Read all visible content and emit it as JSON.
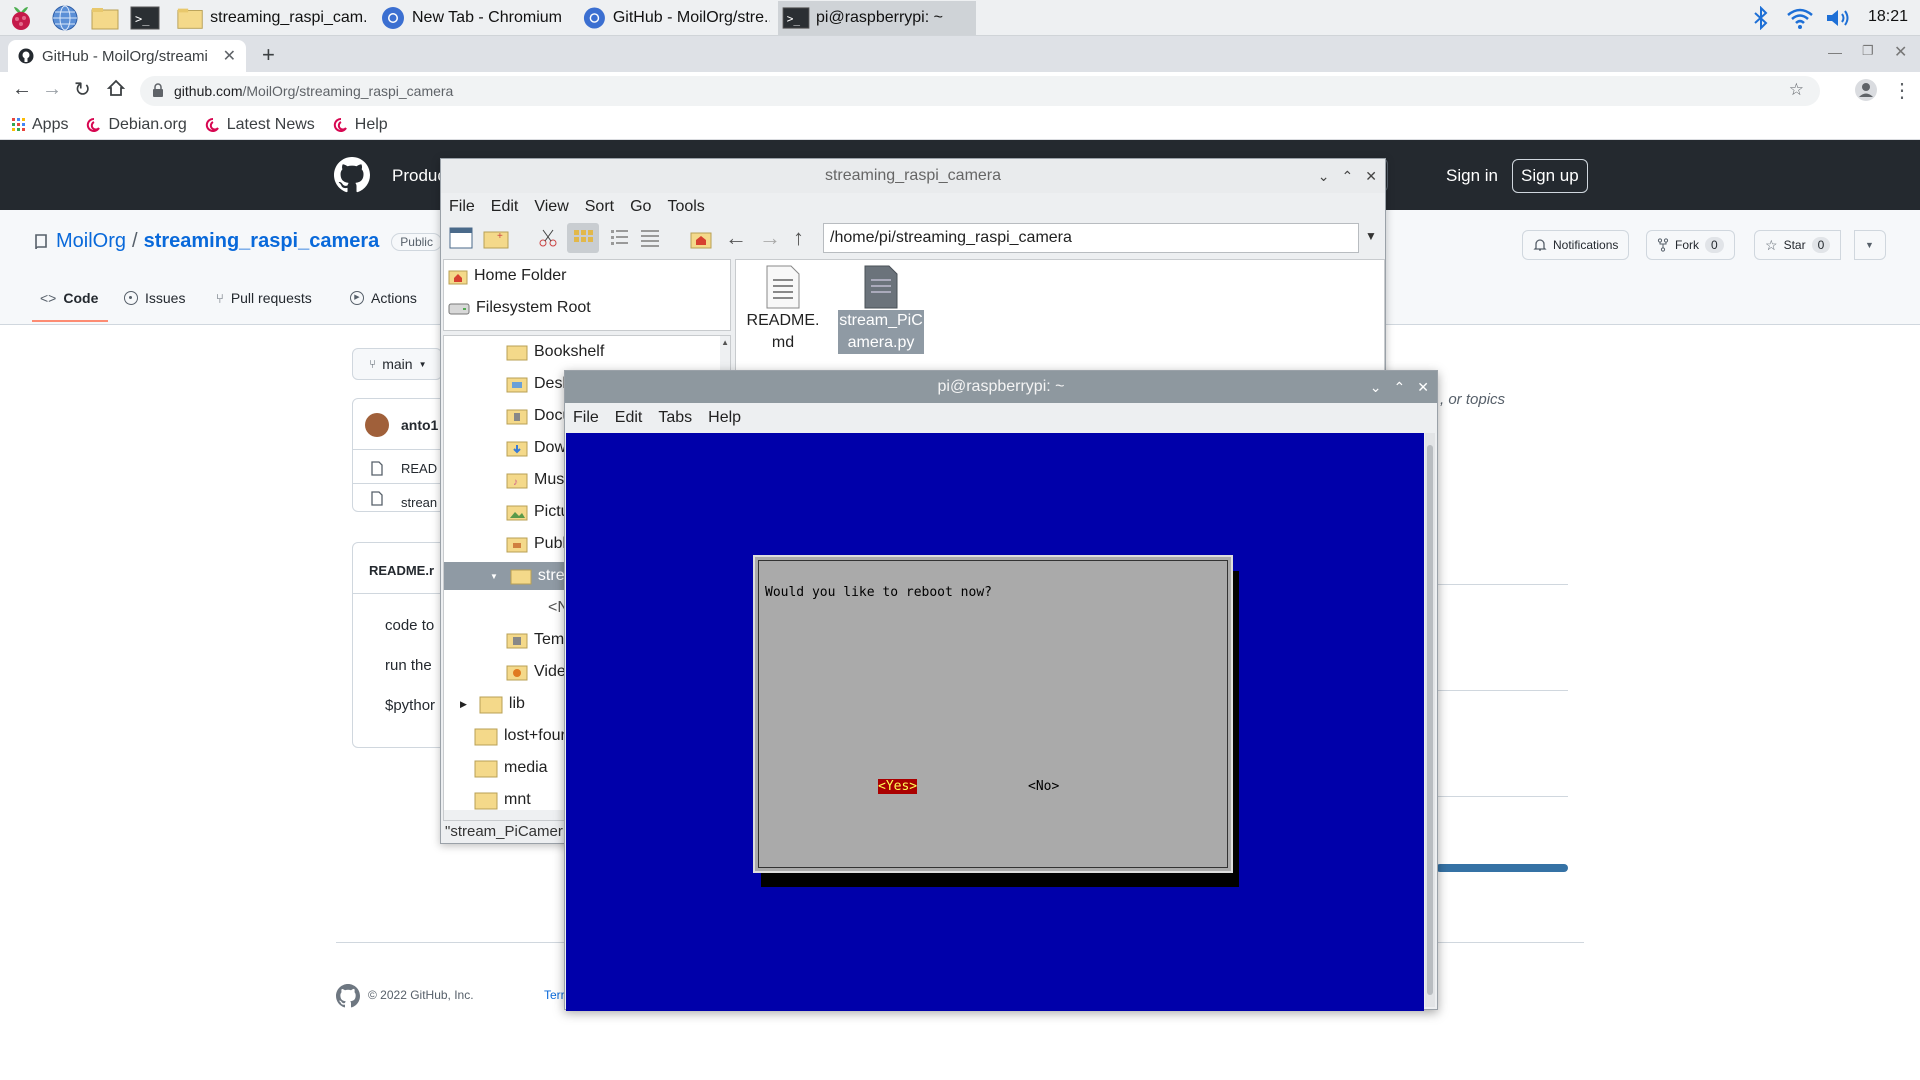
{
  "taskbar": {
    "tasks": [
      {
        "label": "streaming_raspi_cam..."
      },
      {
        "label": "New Tab - Chromium"
      },
      {
        "label": "GitHub - MoilOrg/stre..."
      },
      {
        "label": "pi@raspberrypi: ~"
      }
    ],
    "clock": "18:21"
  },
  "browser": {
    "tab_title": "GitHub - MoilOrg/streami",
    "url_host": "github.com",
    "url_path": "/MoilOrg/streaming_raspi_camera",
    "bookmarks": [
      "Apps",
      "Debian.org",
      "Latest News",
      "Help"
    ]
  },
  "github": {
    "nav_product": "Produc",
    "search_key": "/",
    "sign_in": "Sign in",
    "sign_up": "Sign up",
    "owner": "MoilOrg",
    "separator": "/",
    "repo": "streaming_raspi_camera",
    "visibility": "Public",
    "notifications": "Notifications",
    "fork": "Fork",
    "fork_count": "0",
    "star": "Star",
    "star_count": "0",
    "tabs": [
      "Code",
      "Issues",
      "Pull requests",
      "Actions"
    ],
    "branch": "main",
    "author": "anto1",
    "files": [
      "READ",
      "strean"
    ],
    "readme_title": "README.r",
    "readme_lines": [
      "code to",
      "run the",
      "$pythor"
    ],
    "about_tail": ", or topics",
    "footer_copyright": "© 2022 GitHub, Inc.",
    "footer_link": "Terr"
  },
  "file_manager": {
    "title": "streaming_raspi_camera",
    "menu": [
      "File",
      "Edit",
      "View",
      "Sort",
      "Go",
      "Tools"
    ],
    "path": "/home/pi/streaming_raspi_camera",
    "places": [
      "Home Folder",
      "Filesystem Root"
    ],
    "tree": [
      "Bookshelf",
      "Desk",
      "Docu",
      "Dow",
      "Mus",
      "Pictu",
      "Publ",
      "strea",
      "<N",
      "Tem",
      "Vide",
      "lib",
      "lost+four",
      "media",
      "mnt"
    ],
    "files": [
      {
        "name": "README.md"
      },
      {
        "name": "stream_PiCamera.py"
      }
    ],
    "status": "\"stream_PiCamer"
  },
  "terminal": {
    "title": "pi@raspberrypi: ~",
    "menu": [
      "File",
      "Edit",
      "Tabs",
      "Help"
    ],
    "dialog_question": "Would you like to reboot now?",
    "yes_label": "<Yes>",
    "no_label": "<No>"
  },
  "colors": {
    "github_header": "#24292f",
    "link_blue": "#0969da",
    "terminal_bg": "#0000aa",
    "dialog_gray": "#aaaaaa",
    "yes_highlight": "#aa0000"
  },
  "icons": [
    "raspberry-icon",
    "globe-icon",
    "folder-icon",
    "terminal-icon",
    "chromium-icon",
    "github-icon",
    "bluetooth-icon",
    "wifi-icon",
    "volume-icon",
    "home-icon",
    "arrow-up-icon",
    "bell-icon",
    "star-icon",
    "fork-icon"
  ]
}
